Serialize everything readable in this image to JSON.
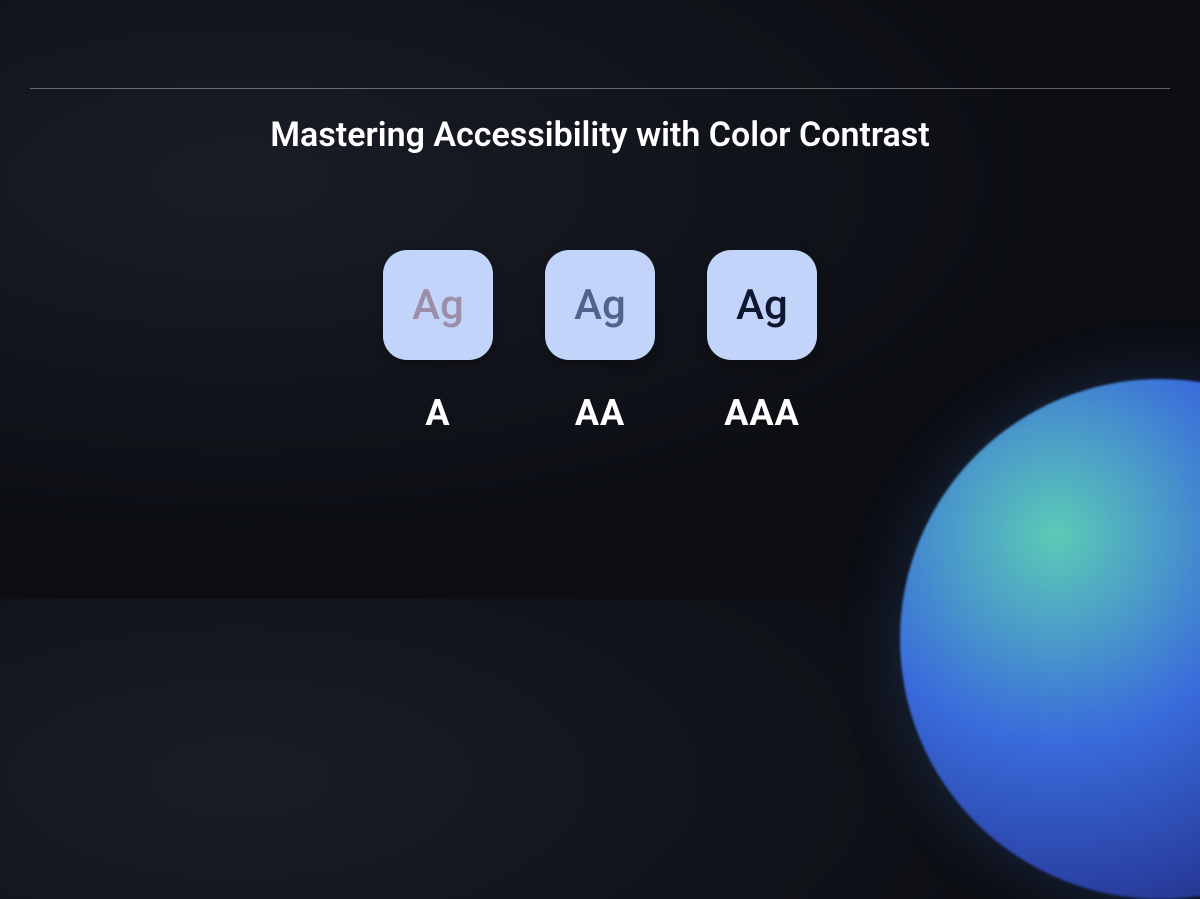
{
  "title": "Mastering Accessibility with Color Contrast",
  "swatch_text": "Ag",
  "levels": {
    "a": {
      "label": "A",
      "text_color": "#9c8ea8"
    },
    "aa": {
      "label": "AA",
      "text_color": "#536288"
    },
    "aaa": {
      "label": "AAA",
      "text_color": "#0e1630"
    }
  },
  "colors": {
    "swatch_bg": "#c2d4fa",
    "page_bg": "#0c0e14",
    "title_color": "#ffffff"
  }
}
